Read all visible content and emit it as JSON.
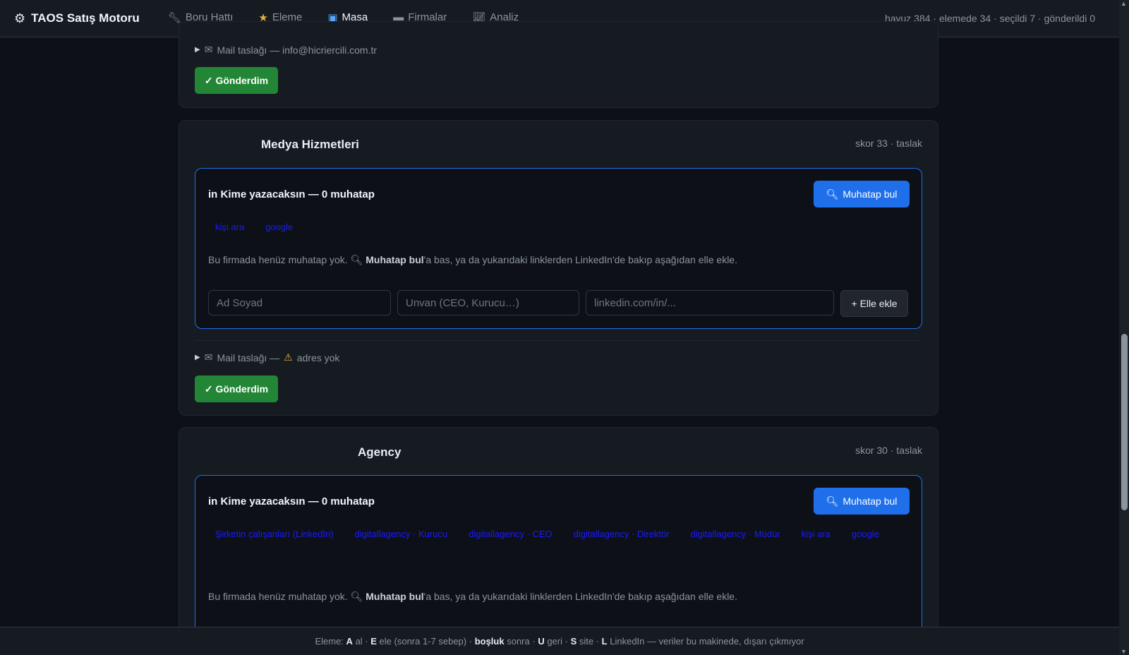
{
  "app": {
    "title": "TAOS Satış Motoru"
  },
  "nav": {
    "tabs": [
      {
        "label": "Boru Hattı",
        "icon": "wrench-icon"
      },
      {
        "label": "Eleme",
        "icon": "star-icon"
      },
      {
        "label": "Masa",
        "icon": "desk-icon",
        "active": true
      },
      {
        "label": "Firmalar",
        "icon": "folder-icon"
      },
      {
        "label": "Analiz",
        "icon": "chart-icon"
      }
    ],
    "stats": "havuz 384 · elemede 34 · seçildi 7 · gönderildi 0"
  },
  "cards": [
    {
      "mail": "Mail taslağı — info@hicriercili.com.tr",
      "sent_label": "✓ Gönderdim"
    },
    {
      "company": "Medya Hizmetleri",
      "score": "skor 33 · taslak",
      "contact_title": "in Kime yazacaksın — 0 muhatap",
      "find_label": "Muhatap bul",
      "links": [
        "kişi ara",
        "google"
      ],
      "hint_pre": "Bu firmada henüz muhatap yok.",
      "hint_bold": "Muhatap bul",
      "hint_post": "'a bas, ya da yukarıdaki linklerden LinkedIn'de bakıp aşağıdan elle ekle.",
      "ph_name": "Ad Soyad",
      "ph_title": "Unvan (CEO, Kurucu…)",
      "ph_linkedin": "linkedin.com/in/...",
      "add_label": "+ Elle ekle",
      "mail_pre": "Mail taslağı —",
      "mail_warn": "adres yok",
      "sent_label": "✓ Gönderdim"
    },
    {
      "company": "Agency",
      "score": "skor 30 · taslak",
      "contact_title": "in Kime yazacaksın — 0 muhatap",
      "find_label": "Muhatap bul",
      "links": [
        "Şirketin çalışanları (LinkedIn)",
        "digitallagency · Kurucu",
        "digitallagency · CEO",
        "digitallagency · Direktör",
        "digitallagency · Müdür",
        "kişi ara",
        "google"
      ],
      "hint_pre": "Bu firmada henüz muhatap yok.",
      "hint_bold": "Muhatap bul",
      "hint_post": "'a bas, ya da yukarıdaki linklerden LinkedIn'de bakıp aşağıdan elle ekle."
    }
  ],
  "footer": {
    "p1": "Eleme:",
    "k1": "A",
    "p2": "al ·",
    "k2": "E",
    "p3": "ele (sonra 1-7 sebep) ·",
    "k3": "boşluk",
    "p4": "sonra ·",
    "k4": "U",
    "p5": "geri ·",
    "k5": "S",
    "p6": "site ·",
    "k6": "L",
    "p7": "LinkedIn — veriler bu makinede, dışarı çıkmıyor"
  }
}
